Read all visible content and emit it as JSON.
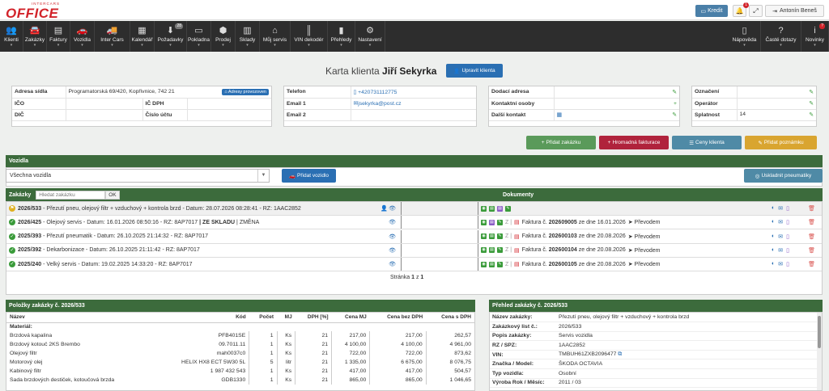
{
  "app": {
    "logo_small": "INTERCARS",
    "logo_big": "OFFICE"
  },
  "topbar": {
    "kredit": "Kredit",
    "notif_count": "1",
    "user": "Antonín Beneš"
  },
  "nav": [
    {
      "label": "Klienti",
      "icon": "users-icon",
      "glyph": "👥",
      "badge": ""
    },
    {
      "label": "Zakázky",
      "icon": "car-service-icon",
      "glyph": "🚘",
      "badge": ""
    },
    {
      "label": "Faktury",
      "icon": "invoice-icon",
      "glyph": "▤",
      "badge": ""
    },
    {
      "label": "Vozidla",
      "icon": "car-icon",
      "glyph": "🚗",
      "badge": ""
    },
    {
      "label": "Inter Cars",
      "icon": "truck-icon",
      "glyph": "🚚",
      "badge": ""
    },
    {
      "label": "Kalendář",
      "icon": "calendar-icon",
      "glyph": "▦",
      "badge": ""
    },
    {
      "label": "Požadavky",
      "icon": "download-icon",
      "glyph": "⬇",
      "badge": "28"
    },
    {
      "label": "Pokladna",
      "icon": "cash-icon",
      "glyph": "▭",
      "badge": ""
    },
    {
      "label": "Prodej",
      "icon": "box-icon",
      "glyph": "⬢",
      "badge": ""
    },
    {
      "label": "Sklady",
      "icon": "warehouse-icon",
      "glyph": "▥",
      "badge": ""
    },
    {
      "label": "Můj servis",
      "icon": "home-icon",
      "glyph": "⌂",
      "badge": ""
    },
    {
      "label": "VIN dekodér",
      "icon": "barcode-icon",
      "glyph": "║",
      "badge": ""
    },
    {
      "label": "Přehledy",
      "icon": "chart-icon",
      "glyph": "▮",
      "badge": ""
    },
    {
      "label": "Nastavení",
      "icon": "gear-icon",
      "glyph": "⚙",
      "badge": ""
    }
  ],
  "nav_right": [
    {
      "label": "Nápověda",
      "icon": "book-icon",
      "glyph": "▯",
      "badge": ""
    },
    {
      "label": "Časté dotazy",
      "icon": "question-icon",
      "glyph": "?",
      "badge": ""
    },
    {
      "label": "Novinky",
      "icon": "info-icon",
      "glyph": "i",
      "badge": "?"
    }
  ],
  "client": {
    "title_prefix": "Karta klienta",
    "name": "Jiří Sekyrka",
    "edit_label": "Upravit klienta",
    "adresa_label": "Adresa sídla",
    "adresa": "Programatorská 69/420, Kopřivnice, 742 21",
    "adresy_btn": "Adresy provozoven",
    "ico_label": "IČO",
    "dic_label": "DIČ",
    "icdph_label": "IČ DPH",
    "ucet_label": "Číslo účtu",
    "telefon_label": "Telefon",
    "telefon": "+420731112775",
    "email1_label": "Email 1",
    "email1": "jsekyrka@post.cz",
    "email2_label": "Email 2",
    "dodaci_label": "Dodací adresa",
    "kontaktni_label": "Kontaktní osoby",
    "dalsi_label": "Další kontakt",
    "oznaceni_label": "Označení",
    "operator_label": "Operátor",
    "splatnost_label": "Splatnost",
    "splatnost": "14"
  },
  "actions": {
    "pridat_zakazku": "Přidat zakázku",
    "hromadna": "Hromadná fakturace",
    "ceny": "Ceny klienta",
    "poznamka": "Přidat poznámku"
  },
  "vozidla": {
    "header": "Vozidla",
    "select": "Všechna vozidla",
    "pridat": "Přidat vozidlo",
    "uskladnit": "Uskladnit pneumatiky"
  },
  "zakazky": {
    "header": "Zakázky",
    "search_placeholder": "Hledat zakázku",
    "ok": "OK",
    "dokumenty": "Dokumenty",
    "rows": [
      {
        "status": "warn",
        "num": "2026/533",
        "text": "Přezutí pneu, olejový filtr + vzduchový + kontrola brzd - Datum: 28.07.2026 08:28:41 - RZ: 1AAC2852",
        "extra": "",
        "invoice": "",
        "invoice_date": "",
        "payment": ""
      },
      {
        "status": "ok",
        "num": "2026/425",
        "text": "Olejový servis - Datum: 16.01.2026 08:50:16 - RZ: 8AP7017",
        "extra": "ZE SKLADU | ZMĚNA",
        "invoice": "202609005",
        "invoice_date": "ze dne 16.01.2026",
        "payment": "Převodem"
      },
      {
        "status": "ok",
        "num": "2025/393",
        "text": "Přezutí pneumatik - Datum: 26.10.2025 21:14:32 - RZ: 8AP7017",
        "extra": "",
        "invoice": "202600103",
        "invoice_date": "ze dne 20.08.2026",
        "payment": "Převodem"
      },
      {
        "status": "ok",
        "num": "2025/392",
        "text": "Dekarbonizace - Datum: 26.10.2025 21:11:42 - RZ: 8AP7017",
        "extra": "",
        "invoice": "202600104",
        "invoice_date": "ze dne 20.08.2026",
        "payment": "Převodem"
      },
      {
        "status": "ok",
        "num": "2025/240",
        "text": "Velký servis - Datum: 19.02.2025 14:33:20 - RZ: 8AP7017",
        "extra": "",
        "invoice": "202600105",
        "invoice_date": "ze dne 20.08.2026",
        "payment": "Převodem"
      }
    ],
    "invoice_prefix": "Faktura č.",
    "z": "Z",
    "pag_prefix": "Stránka",
    "pag_cur": "1",
    "pag_mid": "z",
    "pag_total": "1"
  },
  "polozky": {
    "header": "Položky zakázky č. 2026/533",
    "cols": [
      "Název",
      "Kód",
      "Počet",
      "MJ",
      "DPH [%]",
      "Cena MJ",
      "Cena bez DPH",
      "Cena s DPH"
    ],
    "section": "Materiál:",
    "rows": [
      [
        "Brzdová kapalina",
        "PFB401SE",
        "1",
        "Ks",
        "21",
        "217,00",
        "217,00",
        "262,57"
      ],
      [
        "Brzdový kotouč 2KS Brembo",
        "09.7011.11",
        "1",
        "Ks",
        "21",
        "4 100,00",
        "4 100,00",
        "4 961,00"
      ],
      [
        "Olejový filtr",
        "mah0037c0",
        "1",
        "Ks",
        "21",
        "722,00",
        "722,00",
        "873,62"
      ],
      [
        "Motorový olej",
        "HELIX HX8 ECT 5W30 5L",
        "5",
        "litr",
        "21",
        "1 335,00",
        "6 675,00",
        "8 076,75"
      ],
      [
        "Kabinový filtr",
        "1 987 432 543",
        "1",
        "Ks",
        "21",
        "417,00",
        "417,00",
        "504,57"
      ],
      [
        "Sada brzdových destiček, kotoučová brzda",
        "GDB1330",
        "1",
        "Ks",
        "21",
        "865,00",
        "865,00",
        "1 046,65"
      ]
    ]
  },
  "prehled": {
    "header": "Přehled zakázky č. 2026/533",
    "rows": [
      [
        "Název zakázky:",
        "Přezutí pneu, olejový filtr + vzduchový + kontrola brzd"
      ],
      [
        "Zakázkový list č.:",
        "2026/533"
      ],
      [
        "Popis zakázky:",
        "Servis vozidla"
      ],
      [
        "RZ / SPZ:",
        "1AAC2852"
      ],
      [
        "VIN:",
        "TMBUH61ZXB2096477"
      ],
      [
        "Značka / Model:",
        "ŠKODA OCTAVIA"
      ],
      [
        "Typ vozidla:",
        "Osobní"
      ],
      [
        "Výroba Rok / Měsíc:",
        "2011 / 03"
      ]
    ]
  }
}
